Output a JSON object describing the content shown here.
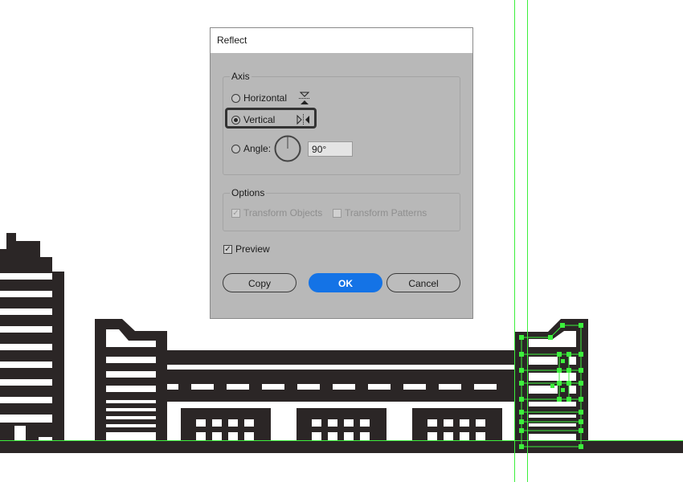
{
  "dialog": {
    "title": "Reflect",
    "axis": {
      "label": "Axis",
      "horizontal": "Horizontal",
      "vertical": "Vertical",
      "angle_label": "Angle:",
      "angle_value": "90°",
      "selected": "vertical"
    },
    "options": {
      "label": "Options",
      "transform_objects": "Transform Objects",
      "transform_objects_checked": true,
      "transform_patterns": "Transform Patterns",
      "transform_patterns_checked": false
    },
    "preview": {
      "label": "Preview",
      "checked": true
    },
    "buttons": {
      "copy": "Copy",
      "ok": "OK",
      "cancel": "Cancel"
    }
  },
  "colors": {
    "artwork": "#2b2626",
    "guide": "#3cf03c",
    "accent": "#1473e6",
    "dialog_bg": "#b8b8b8"
  }
}
